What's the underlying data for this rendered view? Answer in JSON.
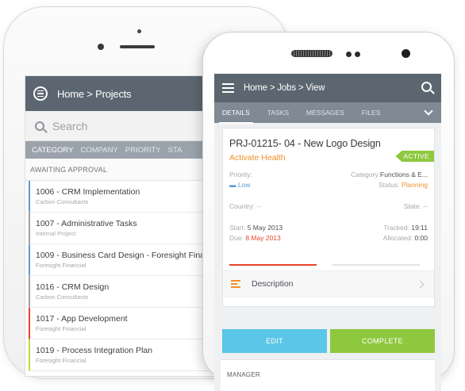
{
  "back_phone": {
    "breadcrumb": "Home > Projects",
    "search_placeholder": "Search",
    "tabs": [
      "CATEGORY",
      "COMPANY",
      "PRIORITY",
      "STA"
    ],
    "group_label": "AWAITING APPROVAL",
    "items": [
      {
        "title": "1006 - CRM Implementation",
        "subtitle": "Carbon Consultants",
        "color": "#5b9bd5"
      },
      {
        "title": "1007 - Administrative Tasks",
        "subtitle": "Internal Project",
        "color": "#9aa1a8"
      },
      {
        "title": "1009 - Business Card Design - Foresight Fina",
        "subtitle": "Foresight Financial",
        "color": "#5b9bd5"
      },
      {
        "title": "1016 - CRM Design",
        "subtitle": "Carbon Consultants",
        "color": "#9aa1a8"
      },
      {
        "title": "1017 - App Development",
        "subtitle": "Foresight Financial",
        "color": "#e8452c"
      },
      {
        "title": "1019 - Process Integration Plan",
        "subtitle": "Foresight Financial",
        "color": "#c8d43a"
      }
    ]
  },
  "front_phone": {
    "breadcrumb": "Home > Jobs > View",
    "tabs": [
      "DETAILS",
      "TASKS",
      "MESSAGES",
      "FILES"
    ],
    "job_title": "PRJ-01215- 04 - New Logo Design",
    "client": "Activate Health",
    "status_badge": "ACTIVE",
    "priority_label": "Priority:",
    "priority_value": "Low",
    "category_label": "Category:",
    "category_value": "Functions & E...",
    "status_label": "Status:",
    "status_value": "Planning",
    "country_label": "Country:",
    "country_value": "--",
    "state_label": "State:",
    "state_value": "--",
    "start_label": "Start:",
    "start_value": "5 May 2013",
    "due_label": "Due:",
    "due_value": "8 May 2013",
    "tracked_label": "Tracked:",
    "tracked_value": "19:11",
    "allocated_label": "Allocated:",
    "allocated_value": "0:00",
    "description_label": "Description",
    "edit_label": "EDIT",
    "complete_label": "COMPLETE",
    "manager_label": "MANAGER"
  },
  "colors": {
    "header": "#5c6670",
    "accent_orange": "#f0902a",
    "accent_green": "#8ec83e",
    "accent_blue": "#5bc6e8",
    "due_red": "#e8452c"
  }
}
